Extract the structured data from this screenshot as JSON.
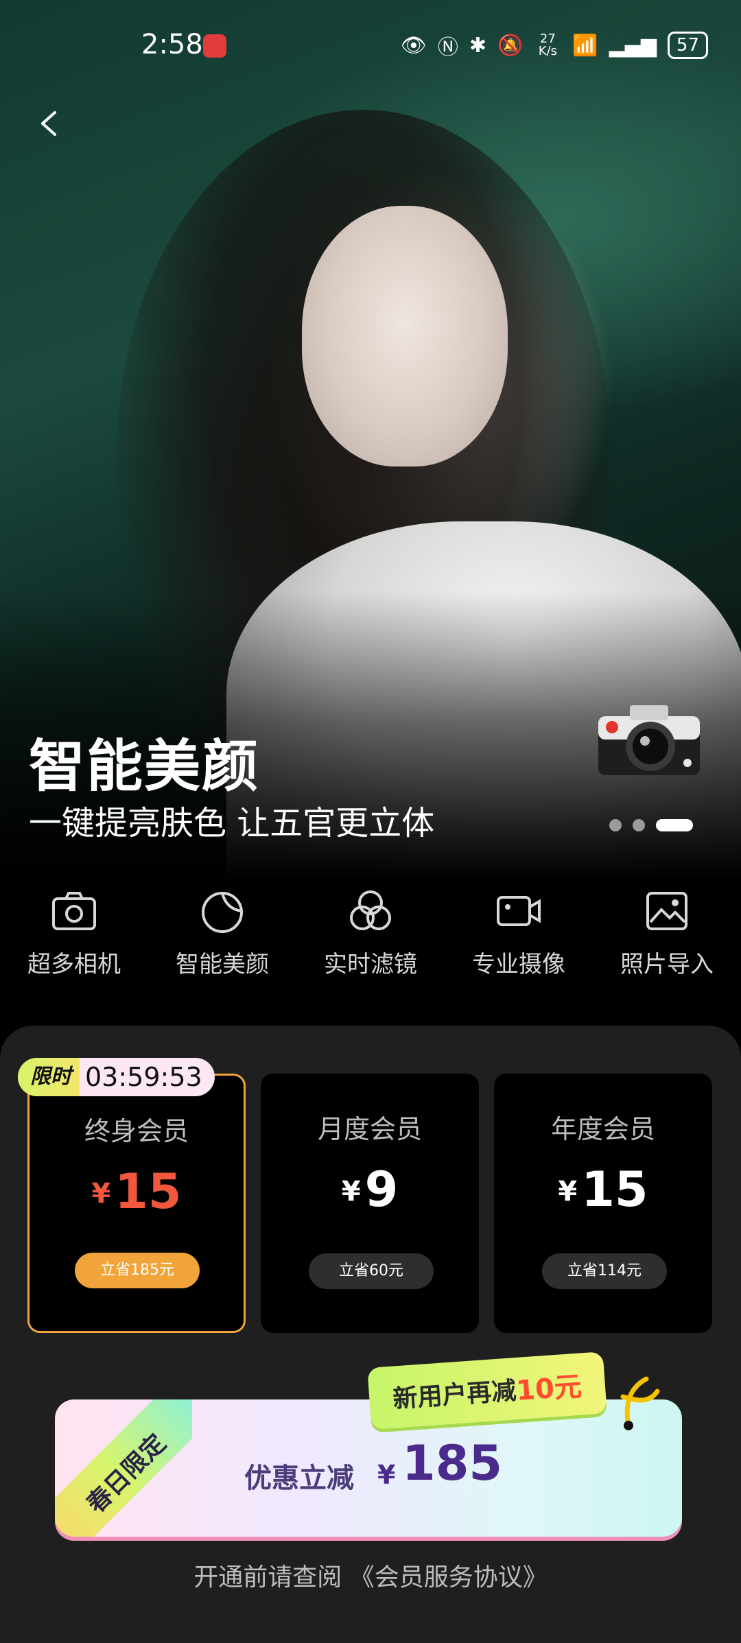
{
  "status_bar": {
    "time": "2:58",
    "net_speed": "27 K/s",
    "battery": "57"
  },
  "hero": {
    "title": "智能美颜",
    "subtitle": "一键提亮肤色 让五官更立体",
    "slides": 3,
    "active_slide": 3
  },
  "features": [
    {
      "label": "超多相机",
      "icon": "camera-icon"
    },
    {
      "label": "智能美颜",
      "icon": "beauty-icon"
    },
    {
      "label": "实时滤镜",
      "icon": "filter-icon"
    },
    {
      "label": "专业摄像",
      "icon": "video-icon"
    },
    {
      "label": "照片导入",
      "icon": "image-icon"
    }
  ],
  "timer": {
    "tag": "限时",
    "value": "03:59:53"
  },
  "plans": [
    {
      "name": "终身会员",
      "currency": "¥",
      "price": "15",
      "save": "立省185元",
      "selected": true
    },
    {
      "name": "月度会员",
      "currency": "¥",
      "price": "9",
      "save": "立省60元",
      "selected": false
    },
    {
      "name": "年度会员",
      "currency": "¥",
      "price": "15",
      "save": "立省114元",
      "selected": false
    }
  ],
  "promo": {
    "corner_tag": "春日限定",
    "label": "优惠立减",
    "currency": "¥",
    "amount": "185",
    "new_user_prefix": "新用户再减",
    "new_user_amount": "10元"
  },
  "agreement": "开通前请查阅 《会员服务协议》",
  "colors": {
    "accent": "#f0a43a",
    "price_red": "#f2583e",
    "promo_purple": "#4a2a8a"
  }
}
